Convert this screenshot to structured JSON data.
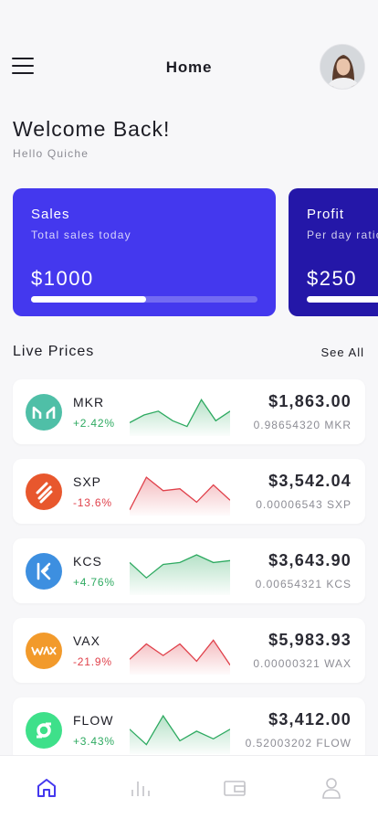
{
  "header": {
    "title": "Home"
  },
  "welcome": {
    "title": "Welcome Back!",
    "subtitle": "Hello Quiche"
  },
  "cards": [
    {
      "title": "Sales",
      "subtitle": "Total sales today",
      "value": "$1000",
      "progress": 0.51
    },
    {
      "title": "Profit",
      "subtitle": "Per day ratio",
      "value": "$250",
      "progress": 0.5
    }
  ],
  "live_prices": {
    "title": "Live Prices",
    "see_all": "See All"
  },
  "coins": [
    {
      "symbol": "MKR",
      "change": "+2.42%",
      "trend": "up",
      "price": "$1,863.00",
      "amount": "0.98654320 MKR",
      "color": "#4fbfa7",
      "icon": "mkr-logo-icon",
      "spark": [
        0.3,
        0.5,
        0.6,
        0.35,
        0.2,
        0.9,
        0.35,
        0.6
      ]
    },
    {
      "symbol": "SXP",
      "change": "-13.6%",
      "trend": "down",
      "price": "$3,542.04",
      "amount": "0.00006543 SXP",
      "color": "#e8572d",
      "icon": "sxp-logo-icon",
      "spark": [
        0.1,
        0.95,
        0.6,
        0.65,
        0.3,
        0.75,
        0.35
      ]
    },
    {
      "symbol": "KCS",
      "change": "+4.76%",
      "trend": "up",
      "price": "$3,643.90",
      "amount": "0.00654321 KCS",
      "color": "#3d8fe0",
      "icon": "kcs-logo-icon",
      "spark": [
        0.8,
        0.4,
        0.75,
        0.8,
        1.0,
        0.8,
        0.85
      ]
    },
    {
      "symbol": "VAX",
      "change": "-21.9%",
      "trend": "down",
      "price": "$5,983.93",
      "amount": "0.00000321 WAX",
      "color": "#f29a2b",
      "icon": "wax-logo-icon",
      "spark": [
        0.35,
        0.75,
        0.45,
        0.75,
        0.3,
        0.85,
        0.2
      ]
    },
    {
      "symbol": "FLOW",
      "change": "+3.43%",
      "trend": "up",
      "price": "$3,412.00",
      "amount": "0.52003202 FLOW",
      "color": "#3ee08a",
      "icon": "flow-logo-icon",
      "spark": [
        0.6,
        0.2,
        0.95,
        0.3,
        0.55,
        0.35,
        0.6
      ]
    }
  ],
  "nav": [
    {
      "name": "nav-home",
      "icon": "home-icon",
      "active": true
    },
    {
      "name": "nav-stats",
      "icon": "bar-chart-icon",
      "active": false
    },
    {
      "name": "nav-wallet",
      "icon": "wallet-icon",
      "active": false
    },
    {
      "name": "nav-profile",
      "icon": "user-icon",
      "active": false
    }
  ],
  "colors": {
    "primary": "#4438ee",
    "secondary": "#2417a8",
    "positive": "#2eaa61",
    "negative": "#e0414b"
  }
}
